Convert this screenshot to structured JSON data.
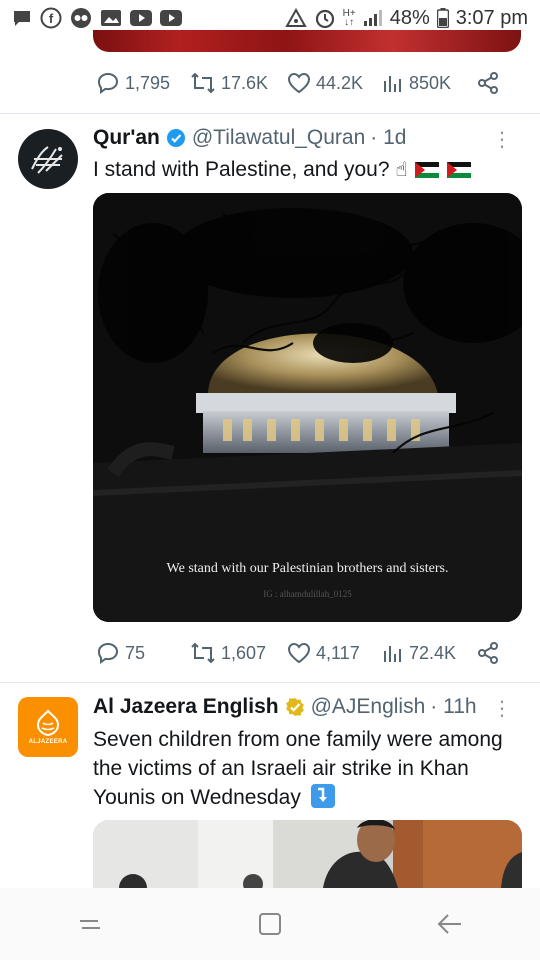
{
  "status_bar": {
    "battery": "48%",
    "time": "3:07 pm",
    "network": "H+"
  },
  "tweet_prev": {
    "replies": "1,795",
    "retweets": "17.6K",
    "likes": "44.2K",
    "views": "850K"
  },
  "tweet1": {
    "name": "Qur'an",
    "handle": "@Tilawatul_Quran",
    "time": "· 1d",
    "text": "I stand with Palestine, and you?",
    "media_caption": "We stand with our Palestinian brothers and sisters.",
    "media_watermark": "IG : alhamdulillah_0125",
    "replies": "75",
    "retweets": "1,607",
    "likes": "4,117",
    "views": "72.4K"
  },
  "tweet2": {
    "name": "Al Jazeera English",
    "handle": "@AJEnglish",
    "time": "· 11h",
    "text": "Seven children from one family were among the victims of an Israeli air strike in Khan Younis on Wednesday",
    "avatar_label": "ALJAZEERA"
  },
  "colors": {
    "accent": "#1d9bf0",
    "muted": "#536471",
    "aj_orange": "#fa9000"
  }
}
